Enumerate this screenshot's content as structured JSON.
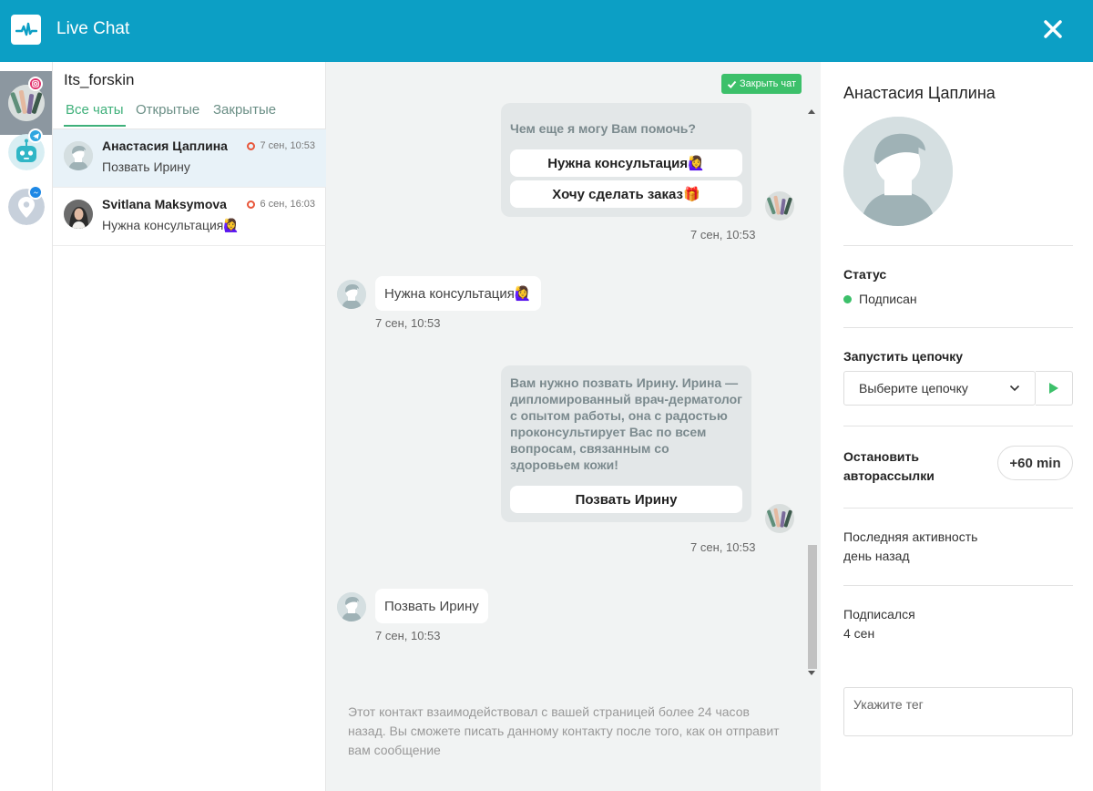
{
  "header": {
    "title": "Live Chat",
    "close_icon": "close-icon",
    "brand_color": "#0c9fc5"
  },
  "rail": {
    "items": [
      {
        "name": "instagram-page",
        "badge": "instagram-icon",
        "badge_color": "#e1306c"
      },
      {
        "name": "telegram-bot",
        "badge": "telegram-icon",
        "badge_color": "#2ea6e0"
      },
      {
        "name": "messenger-page",
        "badge": "messenger-icon",
        "badge_color": "#1e88e5"
      }
    ]
  },
  "list": {
    "page_name": "Its_forskin",
    "tabs": [
      {
        "label": "Все чаты"
      },
      {
        "label": "Открытые"
      },
      {
        "label": "Закрытые"
      }
    ],
    "conversations": [
      {
        "name": "Анастасия Цаплина",
        "time": "7 сен, 10:53",
        "preview": "Позвать Ирину"
      },
      {
        "name": "Svitlana Maksymova",
        "time": "6 сен, 16:03",
        "preview": "Нужна консультация🙋‍♀️"
      }
    ]
  },
  "chat": {
    "close_chat_label": "Закрыть чат",
    "messages": [
      {
        "from": "bot",
        "text": "Чем еще я могу Вам помочь?",
        "buttons": [
          "Нужна консультация🙋‍♀️",
          "Хочу сделать заказ🎁"
        ],
        "time": "7 сен, 10:53"
      },
      {
        "from": "user",
        "text": "Нужна консультация🙋‍♀️",
        "time": "7 сен, 10:53"
      },
      {
        "from": "bot",
        "text": "Вам нужно позвать Ирину. Ирина — дипломированный врач-дерматолог с опытом работы, она с радостью проконсультирует Вас по всем вопросам, связанным со здоровьем кожи!",
        "buttons": [
          "Позвать Ирину"
        ],
        "time": "7 сен, 10:53"
      },
      {
        "from": "user",
        "text": "Позвать Ирину",
        "time": "7 сен, 10:53"
      }
    ],
    "info_note": "Этот контакт взаимодействовал с вашей страницей более 24 часов назад. Вы сможете писать данному контакту после того, как он отправит вам сообщение"
  },
  "panel": {
    "contact_name": "Анастасия Цаплина",
    "status_label": "Статус",
    "status_value": "Подписан",
    "status_color": "#3cc06a",
    "sequence_label": "Запустить цепочку",
    "sequence_select_value": "Выберите цепочку",
    "autopost_label_line1": "Остановить",
    "autopost_label_line2": "авторассылки",
    "autopost_button": "+60 min",
    "last_activity_label": "Последняя активность",
    "last_activity_value": "день назад",
    "subscribed_label": "Подписался",
    "subscribed_value": "4 сен",
    "tag_placeholder": "Укажите тег"
  }
}
